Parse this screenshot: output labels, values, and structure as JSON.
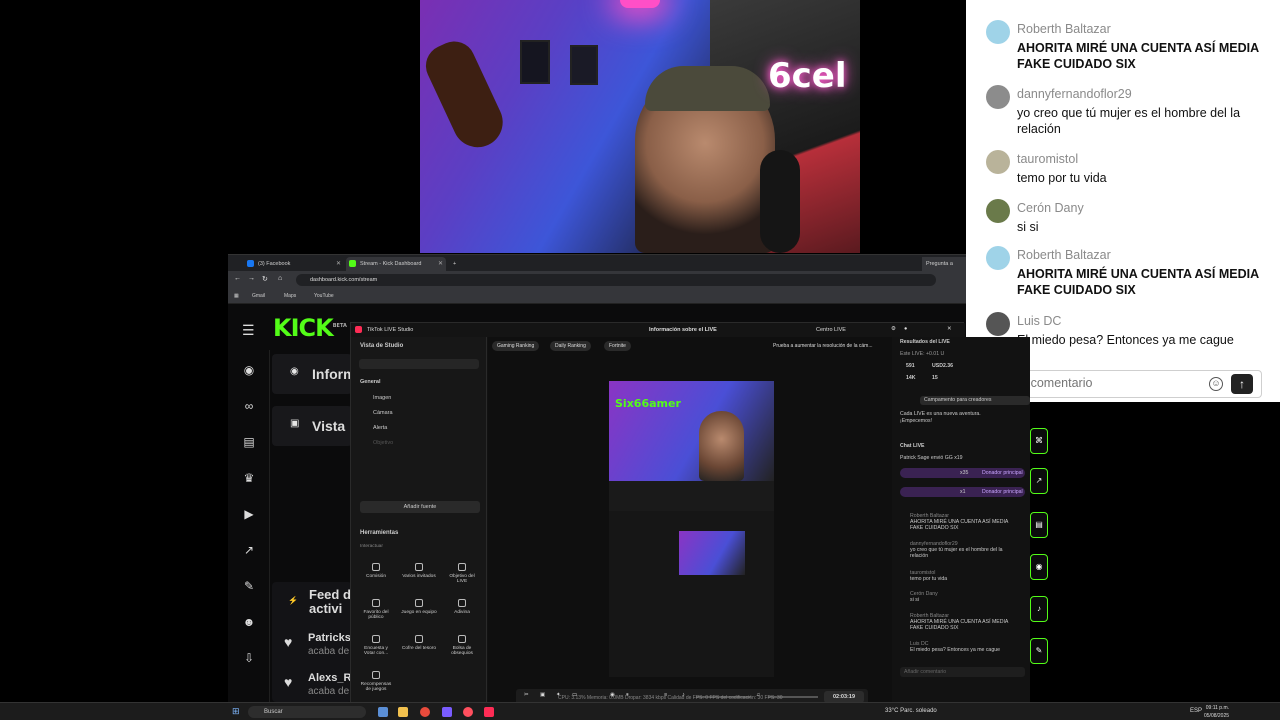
{
  "webcam": {
    "neon_sign": "6cel"
  },
  "chat": {
    "messages": [
      {
        "user": "Roberth Baltazar",
        "text": "AHORITA MIRÉ UNA CUENTA ASÍ MEDIA FAKE CUIDADO SIX",
        "bold": true
      },
      {
        "user": "dannyfernandoflor29",
        "text": "yo creo que tú mujer es el hombre del la relación",
        "bold": false
      },
      {
        "user": "tauromistol",
        "text": "temo por tu vida",
        "bold": false
      },
      {
        "user": "Cerón Dany",
        "text": "si si",
        "bold": false
      },
      {
        "user": "Roberth Baltazar",
        "text": "AHORITA MIRÉ UNA CUENTA ASÍ MEDIA FAKE CUIDADO SIX",
        "bold": true
      },
      {
        "user": "Luis DC",
        "text": "El miedo pesa? Entonces ya me cague",
        "bold": false
      }
    ],
    "comment_placeholder": "Añadir comentario"
  },
  "browser": {
    "tabs": [
      "(3) Facebook",
      "Stream - Kick Dashboard"
    ],
    "url": "dashboard.kick.com/stream",
    "bookmarks": [
      "Gmail",
      "Maps",
      "YouTube"
    ],
    "ask_button": "Pregunta a"
  },
  "kick": {
    "logo": "KICK",
    "logo_badge": "BETA",
    "panel1": "Inform",
    "panel2": "Vista",
    "feed_title": "Feed d",
    "feed_title2": "activi",
    "feed_user1": "Patricks",
    "feed_user1_sub": "acaba de",
    "feed_user2": "Alexs_R",
    "feed_user2_sub": "acaba de"
  },
  "tiktok": {
    "title": "TikTok LIVE Studio",
    "center_title": "Información sobre el LIVE",
    "center_live": "Centro LIVE",
    "view": "Vista de Studio",
    "general": "General",
    "sources": [
      "Imagen",
      "Cámara",
      "Alerta",
      "Objetivo"
    ],
    "add_source": "Añadir fuente",
    "tools_title": "Herramientas",
    "tools_sub": "Interactuar",
    "tools": [
      "Comisión",
      "Varios invitados",
      "Objetivo del LIVE",
      "Favorito del público",
      "Juego en equipo",
      "Adivina",
      "Encuesta y Votar con...",
      "Cofre del tesoro",
      "Bolsa de obsequios",
      "Recompensas de juegos"
    ],
    "pills": [
      "Gaming Ranking",
      "Daily Ranking",
      "Fortnite"
    ],
    "notice": "Prueba a aumentar la resolución de la cám...",
    "preview_logo": "Six66amer",
    "time": "02:03:19",
    "results_title": "Resultados del LIVE",
    "results_line": "Este LIVE: +0.01 U",
    "stats": [
      "591",
      "USD2.36",
      "14K",
      "15"
    ],
    "camp": "Campamento para creadores",
    "camp_sub": "Cada LIVE es una nueva aventura. ¡Empecemos!",
    "chat_title": "Chat LIVE",
    "gift1": "Patrick Sage envió GG x19",
    "gift2": "x35",
    "gift3": "x1",
    "gift_badge": "Donador principal",
    "mini_chat": [
      {
        "user": "Roberth Baltazar",
        "text": "AHORITA MIRÉ UNA CUENTA ASÍ MEDIA FAKE CUIDADO SIX"
      },
      {
        "user": "dannyfernandoflor29",
        "text": "yo creo que tú mujer es el hombre del la relación"
      },
      {
        "user": "tauromistol",
        "text": "temo por tu vida"
      },
      {
        "user": "Cerón Dany",
        "text": "si si"
      },
      {
        "user": "Roberth Baltazar",
        "text": "AHORITA MIRÉ UNA CUENTA ASÍ MEDIA FAKE CUIDADO SIX"
      },
      {
        "user": "Luis DC",
        "text": "El miedo pesa? Entonces ya me cague"
      }
    ],
    "mini_placeholder": "Añadir comentario",
    "status": "CPU: 3.13%    Memoria: 0.0MB    Dropar: 3834 kbps    Calidad de FPS: 0    FPS del codificación: 30    FPS: 30"
  },
  "taskbar": {
    "search": "Buscar",
    "weather": "33°C  Parc. soleado",
    "lang": "ESP",
    "time": "09:11 p.m.",
    "date": "05/08/2025"
  }
}
